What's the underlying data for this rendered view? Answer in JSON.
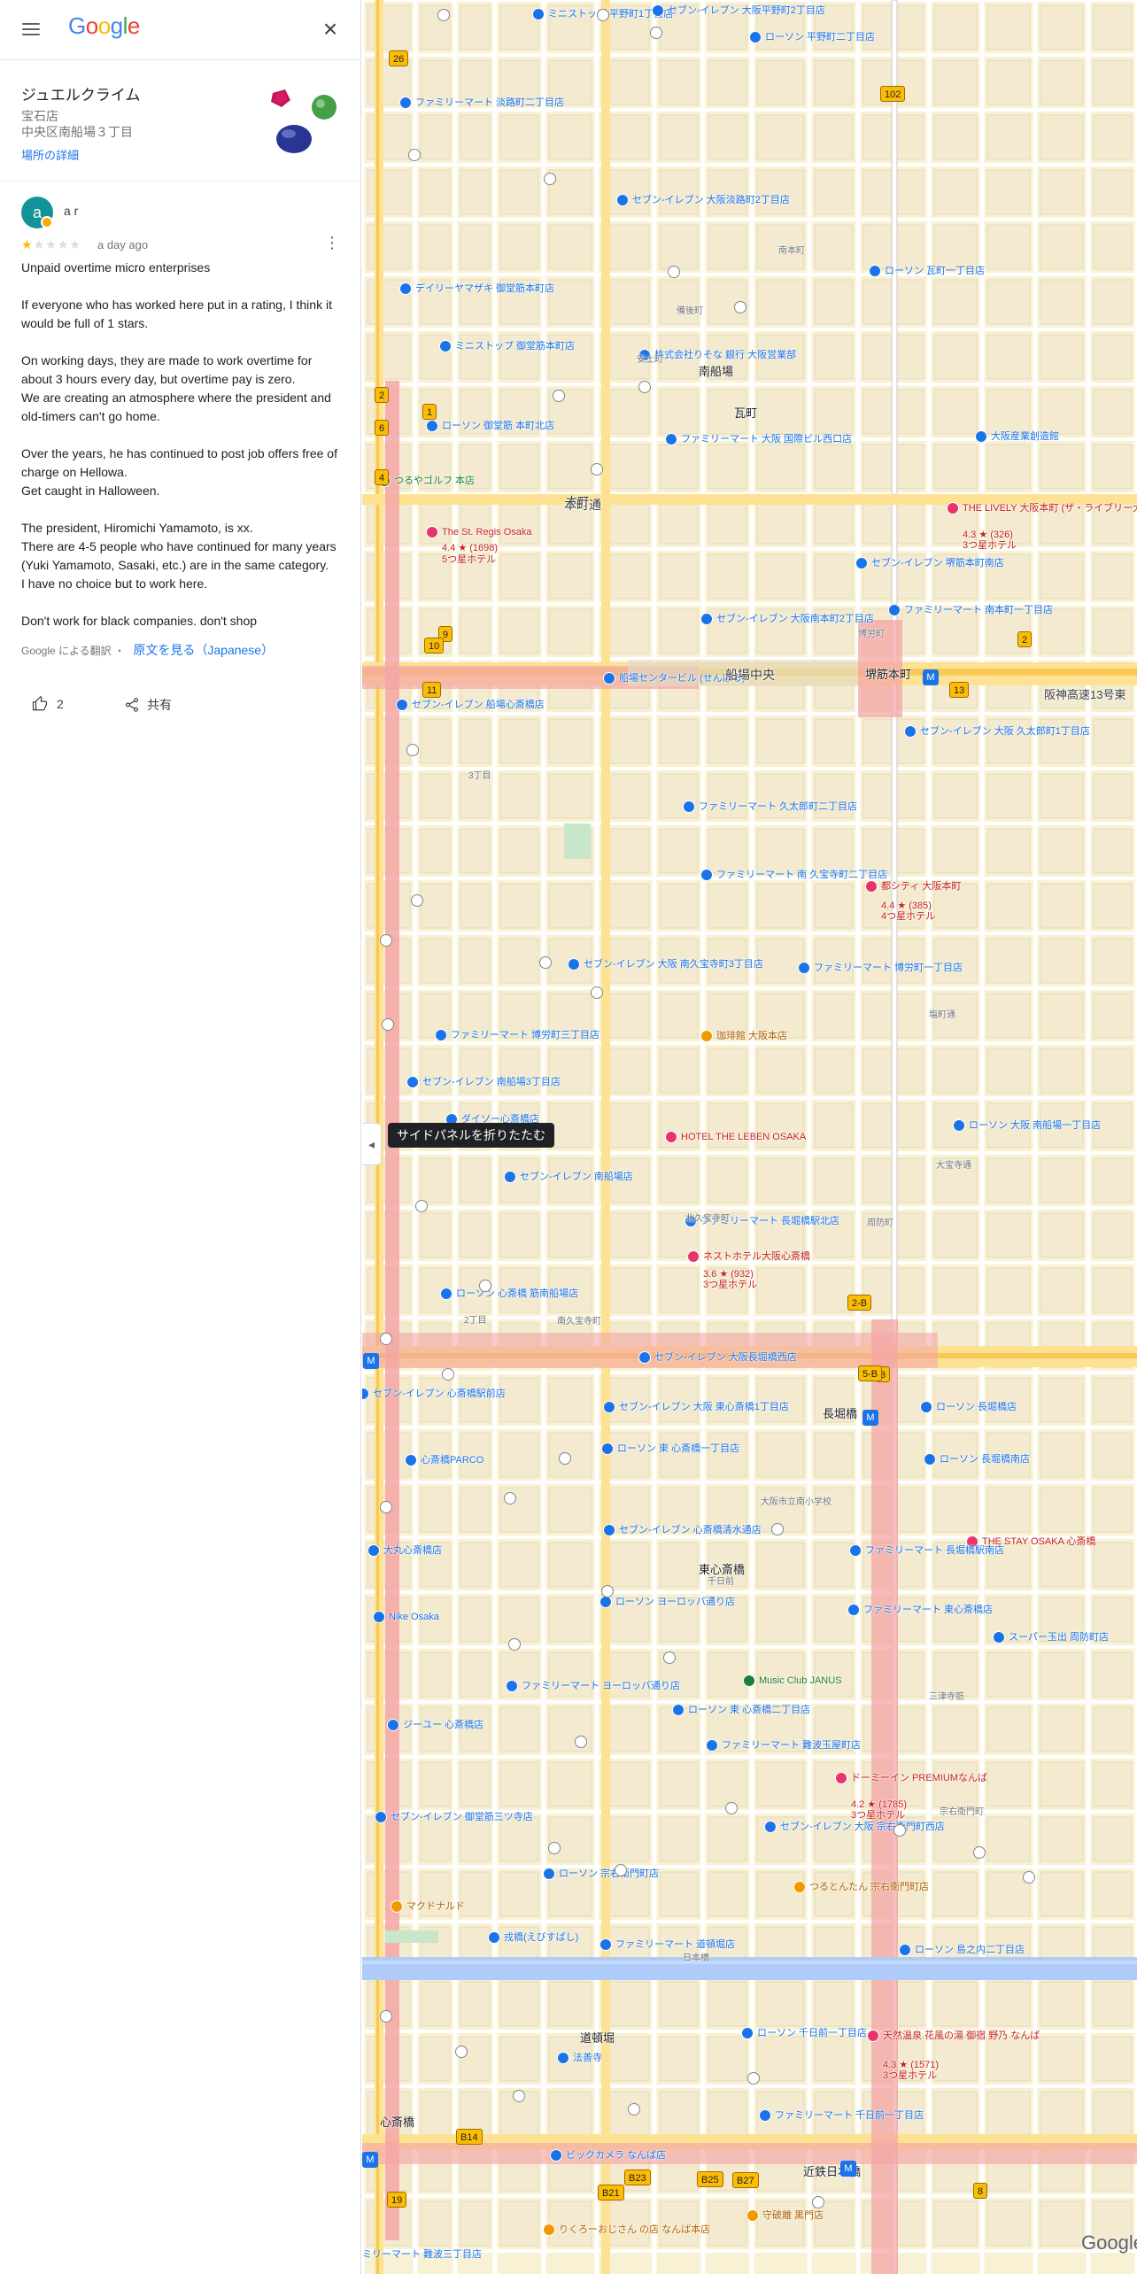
{
  "header": {
    "logo_text": "Google",
    "close_glyph": "×"
  },
  "place": {
    "name": "ジュエルクライム",
    "category": "宝石店",
    "address": "中央区南船場３丁目",
    "details_link": "場所の詳細"
  },
  "review": {
    "avatar_letter": "a",
    "author": "a r",
    "rating": 1,
    "max_rating": 5,
    "time": "a day ago",
    "paragraphs": [
      "Unpaid overtime micro enterprises",
      "",
      "If everyone who has worked here put in a rating, I think it would be full of 1 stars.",
      "",
      "On working days, they are made to work overtime for about 3 hours every day, but overtime pay is zero.",
      "We are creating an atmosphere where the president and old-timers can't go home.",
      "",
      "Over the years, he has continued to post job offers free of charge on Hellowa.",
      "Get caught in Halloween.",
      "",
      "The president, Hiromichi Yamamoto, is xx.",
      "There are 4-5 people who have continued for many years (Yuki Yamamoto, Sasaki, etc.) are in the same category.",
      "I have no choice but to work here.",
      "",
      "Don't work for black companies. don't shop"
    ],
    "translated_by": "Google による翻訳",
    "separator": "・",
    "original_link": "原文を見る（Japanese）",
    "like_count": "2",
    "share_label": "共有"
  },
  "map": {
    "collapse_tooltip": "サイドパネルを折りたたむ",
    "collapse_glyph": "◂",
    "watermark": "Google",
    "roads": {
      "honmachi": "本町通",
      "semba": "船場中央",
      "hanshin": "阪神高速13号東",
      "nagahori": "長堀橋",
      "dotonbori": "道頓堀"
    },
    "labels": [
      {
        "t": "ミニストップ 平野町1丁目店",
        "c": "blue"
      },
      {
        "t": "セブン-イレブン 大阪平野町2丁目店",
        "c": "blue"
      },
      {
        "t": "ローソン 平野町二丁目店",
        "c": "blue"
      },
      {
        "t": "ファミリーマート 淡路町二丁目店",
        "c": "blue"
      },
      {
        "t": "セブン-イレブン 大阪淡路町2丁目店",
        "c": "blue"
      },
      {
        "t": "デイリーヤマザキ 御堂筋本町店",
        "c": "blue"
      },
      {
        "t": "ミニストップ 御堂筋本町店",
        "c": "blue"
      },
      {
        "t": "株式会社りそな 銀行 大阪営業部",
        "c": "blue"
      },
      {
        "t": "ローソン 瓦町一丁目店",
        "c": "blue"
      },
      {
        "t": "ローソン 御堂筋 本町北店",
        "c": "blue"
      },
      {
        "t": "ファミリーマート 大阪 国際ビル西口店",
        "c": "blue"
      },
      {
        "t": "大阪産業創造館",
        "c": "blue"
      },
      {
        "t": "つるやゴルフ 本店",
        "c": "green"
      },
      {
        "t": "The St. Regis Osaka",
        "c": "pink"
      },
      {
        "t": "4.4 ★ (1698)",
        "c": "pink"
      },
      {
        "t": "5つ星ホテル",
        "c": "pink"
      },
      {
        "t": "THE LIVELY 大阪本町 (ザ・ライブリー大阪本町)",
        "c": "pink"
      },
      {
        "t": "4.3 ★ (326)",
        "c": "pink"
      },
      {
        "t": "3つ星ホテル",
        "c": "pink"
      },
      {
        "t": "セブン-イレブン 堺筋本町南店",
        "c": "blue"
      },
      {
        "t": "セブン-イレブン 大阪南本町2丁目店",
        "c": "blue"
      },
      {
        "t": "ファミリーマート 南本町一丁目店",
        "c": "blue"
      },
      {
        "t": "船場センタービル (せんばる)",
        "c": "blue"
      },
      {
        "t": "堺筋本町",
        "c": "big"
      },
      {
        "t": "セブン-イレブン 船場心斎橋店",
        "c": "blue"
      },
      {
        "t": "セブン-イレブン 大阪 久太郎町1丁目店",
        "c": "blue"
      },
      {
        "t": "ファミリーマート 久太郎町二丁目店",
        "c": "blue"
      },
      {
        "t": "ファミリーマート 南 久宝寺町二丁目店",
        "c": "blue"
      },
      {
        "t": "都シティ 大阪本町",
        "c": "pink"
      },
      {
        "t": "4.4 ★ (385)",
        "c": "pink"
      },
      {
        "t": "4つ星ホテル",
        "c": "pink"
      },
      {
        "t": "セブン-イレブン 大阪 南久宝寺町3丁目店",
        "c": "blue"
      },
      {
        "t": "ファミリーマート 博労町一丁目店",
        "c": "blue"
      },
      {
        "t": "ファミリーマート 博労町三丁目店",
        "c": "blue"
      },
      {
        "t": "セブン-イレブン 南船場3丁目店",
        "c": "blue"
      },
      {
        "t": "ダイソー心斎橋店",
        "c": "blue"
      },
      {
        "t": "珈琲館 大阪本店",
        "c": "orange"
      },
      {
        "t": "HOTEL THE LEBEN OSAKA",
        "c": "pink"
      },
      {
        "t": "ローソン 大阪 南船場一丁目店",
        "c": "blue"
      },
      {
        "t": "セブン-イレブン 南船場店",
        "c": "blue"
      },
      {
        "t": "ファミリーマート 長堀橋駅北店",
        "c": "blue"
      },
      {
        "t": "ネストホテル大阪心斎橋",
        "c": "pink"
      },
      {
        "t": "3.6 ★ (932)",
        "c": "pink"
      },
      {
        "t": "3つ星ホテル",
        "c": "pink"
      },
      {
        "t": "ローソン 心斎橋 筋南船場店",
        "c": "blue"
      },
      {
        "t": "セブン-イレブン 大阪長堀橋西店",
        "c": "blue"
      },
      {
        "t": "長堀橋",
        "c": "big"
      },
      {
        "t": "セブン-イレブン 大阪 東心斎橋1丁目店",
        "c": "blue"
      },
      {
        "t": "ローソン 長堀橋店",
        "c": "blue"
      },
      {
        "t": "セブン-イレブン 心斎橋駅前店",
        "c": "blue"
      },
      {
        "t": "心斎橋PARCO",
        "c": "blue"
      },
      {
        "t": "ローソン 東 心斎橋一丁目店",
        "c": "blue"
      },
      {
        "t": "ローソン 長堀橋南店",
        "c": "blue"
      },
      {
        "t": "セブン-イレブン 心斎橋清水通店",
        "c": "blue"
      },
      {
        "t": "大丸心斎橋店",
        "c": "blue"
      },
      {
        "t": "東心斎橋",
        "c": "big"
      },
      {
        "t": "THE STAY OSAKA 心斎橋",
        "c": "pink"
      },
      {
        "t": "ファミリーマート 長堀橋駅南店",
        "c": "blue"
      },
      {
        "t": "ローソン ヨーロッパ通り店",
        "c": "blue"
      },
      {
        "t": "ファミリーマート 東心斎橋店",
        "c": "blue"
      },
      {
        "t": "Nike Osaka",
        "c": "blue"
      },
      {
        "t": "スーパー玉出 周防町店",
        "c": "blue"
      },
      {
        "t": "Music Club JANUS",
        "c": "green"
      },
      {
        "t": "ファミリーマート ヨーロッパ通り店",
        "c": "blue"
      },
      {
        "t": "ローソン 東 心斎橋二丁目店",
        "c": "blue"
      },
      {
        "t": "ジーユー 心斎橋店",
        "c": "blue"
      },
      {
        "t": "ファミリーマート 難波玉屋町店",
        "c": "blue"
      },
      {
        "t": "ドーミーイン PREMIUMなんば",
        "c": "pink"
      },
      {
        "t": "4.2 ★ (1785)",
        "c": "pink"
      },
      {
        "t": "3つ星ホテル",
        "c": "pink"
      },
      {
        "t": "セブン-イレブン 御堂筋三ツ寺店",
        "c": "blue"
      },
      {
        "t": "セブン-イレブン 大阪 宗右衛門町西店",
        "c": "blue"
      },
      {
        "t": "ローソン 宗右衛門町店",
        "c": "blue"
      },
      {
        "t": "つるとんたん 宗右衛門町店",
        "c": "orange"
      },
      {
        "t": "マクドナルド",
        "c": "orange"
      },
      {
        "t": "戎橋(えびすばし)",
        "c": "blue"
      },
      {
        "t": "ファミリーマート 道頓堀店",
        "c": "blue"
      },
      {
        "t": "ローソン 島之内二丁目店",
        "c": "blue"
      },
      {
        "t": "道頓堀",
        "c": "big"
      },
      {
        "t": "ローソン 千日前一丁目店",
        "c": "blue"
      },
      {
        "t": "天然温泉 花風の湯 御宿 野乃 なんば",
        "c": "pink"
      },
      {
        "t": "4.3 ★ (1571)",
        "c": "pink"
      },
      {
        "t": "3つ星ホテル",
        "c": "pink"
      },
      {
        "t": "法善寺",
        "c": "blue"
      },
      {
        "t": "ファミリーマート 千日前一丁目店",
        "c": "blue"
      },
      {
        "t": "ビックカメラ なんば店",
        "c": "blue"
      },
      {
        "t": "近鉄日本橋",
        "c": "big"
      },
      {
        "t": "守破離 黒門店",
        "c": "orange"
      },
      {
        "t": "りくろーおじさん の店 なんば本店",
        "c": "orange"
      },
      {
        "t": "ミリーマート 難波三丁目店",
        "c": "blue"
      },
      {
        "t": "本町",
        "c": "big"
      },
      {
        "t": "心斎橋",
        "c": "big"
      },
      {
        "t": "3丁目",
        "c": "small"
      },
      {
        "t": "2丁目",
        "c": "small"
      },
      {
        "t": "安土町",
        "c": "small"
      },
      {
        "t": "備後町",
        "c": "small"
      },
      {
        "t": "瓦町",
        "c": "big"
      },
      {
        "t": "南船場",
        "c": "big"
      },
      {
        "t": "南本町",
        "c": "small"
      },
      {
        "t": "北久宝寺町",
        "c": "small"
      },
      {
        "t": "南久宝寺町",
        "c": "small"
      },
      {
        "t": "博労町",
        "c": "small"
      },
      {
        "t": "塩町通",
        "c": "small"
      },
      {
        "t": "周防町",
        "c": "small"
      },
      {
        "t": "大宝寺通",
        "c": "small"
      },
      {
        "t": "三津寺筋",
        "c": "small"
      },
      {
        "t": "宗右衛門町",
        "c": "small"
      },
      {
        "t": "大阪市立南小学校",
        "c": "small"
      },
      {
        "t": "千日前",
        "c": "small"
      },
      {
        "t": "日本橋",
        "c": "small"
      }
    ],
    "route_badges": [
      "26",
      "102",
      "2",
      "6",
      "1",
      "4",
      "9",
      "10",
      "11",
      "13",
      "2",
      "3",
      "5-B",
      "2-B",
      "B14",
      "B21",
      "B23",
      "B25",
      "B27",
      "19",
      "8"
    ]
  }
}
